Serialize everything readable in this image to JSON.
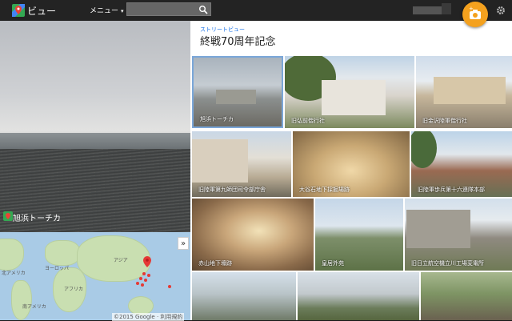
{
  "app": {
    "title": "ビュー"
  },
  "header": {
    "menu_label": "メニュー",
    "search_placeholder": ""
  },
  "pano": {
    "label": "旭浜トーチカ"
  },
  "map": {
    "expand_label": "»",
    "copyright": "©2015 Google · 利用規約",
    "labels": [
      "北アメリカ",
      "ヨーロッパ",
      "アジア",
      "アフリカ",
      "南アメリカ"
    ]
  },
  "panel": {
    "subtitle": "ストリートビュー",
    "title": "終戦70周年記念",
    "tiles": [
      {
        "caption": "旭浜トーチカ"
      },
      {
        "caption": "旧弘前偕行社"
      },
      {
        "caption": "旧金沢陸軍偕行社"
      },
      {
        "caption": "旧陸軍第九師団司令部庁舎"
      },
      {
        "caption": "大谷石地下採掘場跡"
      },
      {
        "caption": "旧陸軍歩兵第十六連隊本部"
      },
      {
        "caption": "赤山地下壕跡"
      },
      {
        "caption": "皇居外苑"
      },
      {
        "caption": "旧日立航空機立川工場変電所"
      },
      {
        "caption": ""
      },
      {
        "caption": ""
      },
      {
        "caption": ""
      }
    ]
  },
  "colors": {
    "accent": "#f4a11e",
    "link": "#1a73e8",
    "topbar": "#232323"
  }
}
